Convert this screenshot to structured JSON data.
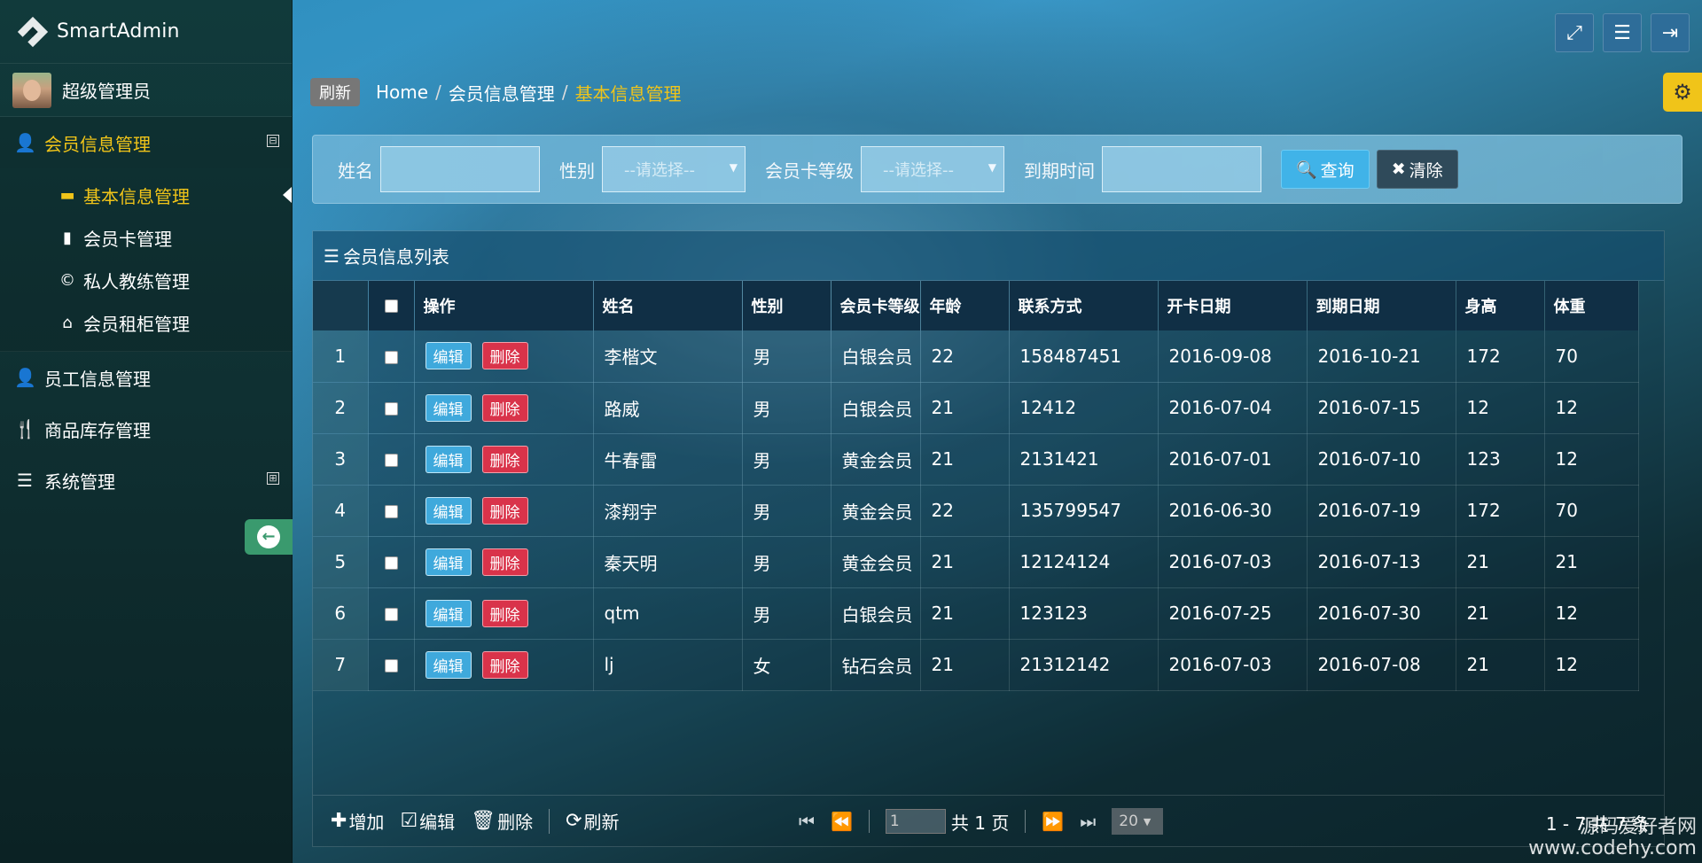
{
  "brand": "SmartAdmin",
  "user_name": "超级管理员",
  "sidebar": {
    "groups": [
      {
        "label": "会员信息管理",
        "icon": "user-icon",
        "toggle": "⊟"
      },
      {
        "label": "员工信息管理",
        "icon": "user-icon"
      },
      {
        "label": "商品库存管理",
        "icon": "cutlery-icon"
      },
      {
        "label": "系统管理",
        "icon": "list-icon",
        "toggle": "⊞"
      }
    ],
    "subitems": [
      {
        "label": "基本信息管理",
        "icon": "folder-icon"
      },
      {
        "label": "会员卡管理",
        "icon": "book-icon"
      },
      {
        "label": "私人教练管理",
        "icon": "copyright-icon"
      },
      {
        "label": "会员租柜管理",
        "icon": "home-icon"
      }
    ]
  },
  "breadcrumb": {
    "refresh": "刷新",
    "home": "Home",
    "sep": "/",
    "level1": "会员信息管理",
    "current": "基本信息管理"
  },
  "search": {
    "name_label": "姓名",
    "gender_label": "性别",
    "gender_value": "--请选择--",
    "card_label": "会员卡等级",
    "card_value": "--请选择--",
    "expire_label": "到期时间",
    "query_label": "查询",
    "clear_label": "清除"
  },
  "panel_title": "会员信息列表",
  "table": {
    "headers": [
      "操作",
      "姓名",
      "性别",
      "会员卡等级",
      "年龄",
      "联系方式",
      "开卡日期",
      "到期日期",
      "身高",
      "体重"
    ],
    "edit_label": "编辑",
    "delete_label": "删除",
    "rows": [
      {
        "n": "1",
        "name": "李楷文",
        "gender": "男",
        "card": "白银会员",
        "age": "22",
        "phone": "158487451",
        "start": "2016-09-08",
        "end": "2016-10-21",
        "height": "172",
        "weight": "70"
      },
      {
        "n": "2",
        "name": "路威",
        "gender": "男",
        "card": "白银会员",
        "age": "21",
        "phone": "12412",
        "start": "2016-07-04",
        "end": "2016-07-15",
        "height": "12",
        "weight": "12"
      },
      {
        "n": "3",
        "name": "牛春雷",
        "gender": "男",
        "card": "黄金会员",
        "age": "21",
        "phone": "2131421",
        "start": "2016-07-01",
        "end": "2016-07-10",
        "height": "123",
        "weight": "12"
      },
      {
        "n": "4",
        "name": "漆翔宇",
        "gender": "男",
        "card": "黄金会员",
        "age": "22",
        "phone": "135799547",
        "start": "2016-06-30",
        "end": "2016-07-19",
        "height": "172",
        "weight": "70"
      },
      {
        "n": "5",
        "name": "秦天明",
        "gender": "男",
        "card": "黄金会员",
        "age": "21",
        "phone": "12124124",
        "start": "2016-07-03",
        "end": "2016-07-13",
        "height": "21",
        "weight": "21"
      },
      {
        "n": "6",
        "name": "qtm",
        "gender": "男",
        "card": "白银会员",
        "age": "21",
        "phone": "123123",
        "start": "2016-07-25",
        "end": "2016-07-30",
        "height": "21",
        "weight": "12"
      },
      {
        "n": "7",
        "name": "lj",
        "gender": "女",
        "card": "钻石会员",
        "age": "21",
        "phone": "21312142",
        "start": "2016-07-03",
        "end": "2016-07-08",
        "height": "21",
        "weight": "12"
      }
    ]
  },
  "toolbar": {
    "add": "增加",
    "edit": "编辑",
    "delete": "删除",
    "refresh": "刷新"
  },
  "pager": {
    "page_value": "1",
    "total_pages": "共 1 页",
    "page_size": "20",
    "info": "1 - 7   共 7 条"
  },
  "watermark": {
    "line1": "源码爱好者网",
    "line2": "www.codehy.com"
  },
  "colors": {
    "accent_yellow": "#f0c419",
    "edit_blue": "#3fa9dc",
    "delete_red": "#d9334a",
    "collapse_green": "#3a9a6e"
  }
}
